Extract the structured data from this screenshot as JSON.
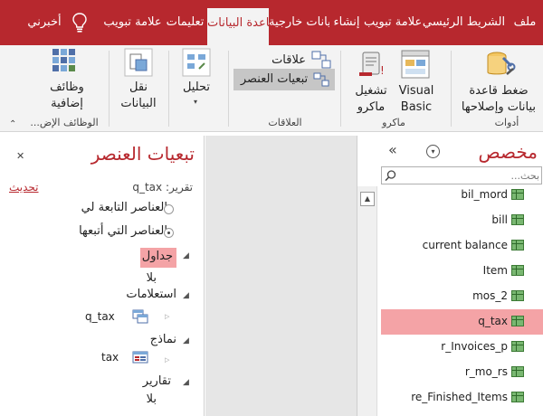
{
  "tabs": [
    {
      "label": "ملف"
    },
    {
      "label": "الشريط الرئيسي"
    },
    {
      "label": "علامة تبويب"
    },
    {
      "label": "إنشاء"
    },
    {
      "label": "بيانات خارجية"
    },
    {
      "label": "أدوات قاعدة البيانات"
    },
    {
      "label": "تعليمات"
    },
    {
      "label": "علامة تبويب"
    },
    {
      "label": "أخبرني"
    }
  ],
  "ribbon": {
    "tools": {
      "compact_repair": "ضغط قاعدة بيانات وإصلاحها",
      "group": "أدوات"
    },
    "macro": {
      "visual_basic": "Visual Basic",
      "run_macro": "تشغيل ماكرو",
      "group": "ماكرو"
    },
    "relationships": {
      "relationships": "علاقات",
      "object_dependencies": "تبعيات العنصر",
      "group": "العلاقات"
    },
    "analyze": {
      "analyze": "تحليل"
    },
    "move_data": {
      "move_data": "نقل البيانات"
    },
    "addins": {
      "addins": "وظائف إضافية",
      "group": "الوظائف الإض..."
    }
  },
  "dependencies": {
    "title": "تبعيات العنصر",
    "report_label": "تقرير: q_tax",
    "refresh": "تحديث",
    "option_depends_on_me": "العناصر التابعة لي",
    "option_i_depend_on": "العناصر التي أتبعها",
    "tables_header": "جداول",
    "tables_value": "بلا",
    "queries_header": "استعلامات",
    "query_item": "q_tax",
    "forms_header": "نماذج",
    "form_item": "tax",
    "reports_header": "تقارير",
    "reports_value": "بلا"
  },
  "nav": {
    "title": "مخصص",
    "search_placeholder": "بحث...",
    "selected": "q_tax",
    "items": [
      {
        "label": "bil_mord"
      },
      {
        "label": "bill"
      },
      {
        "label": "current balance"
      },
      {
        "label": "Item"
      },
      {
        "label": "mos_2"
      },
      {
        "label": "q_tax"
      },
      {
        "label": "r_Invoices_p"
      },
      {
        "label": "r_mo_rs"
      },
      {
        "label": "re_Finished_Items"
      }
    ]
  },
  "colors": {
    "accent": "#b7282e",
    "selection": "#f4a3a6"
  }
}
